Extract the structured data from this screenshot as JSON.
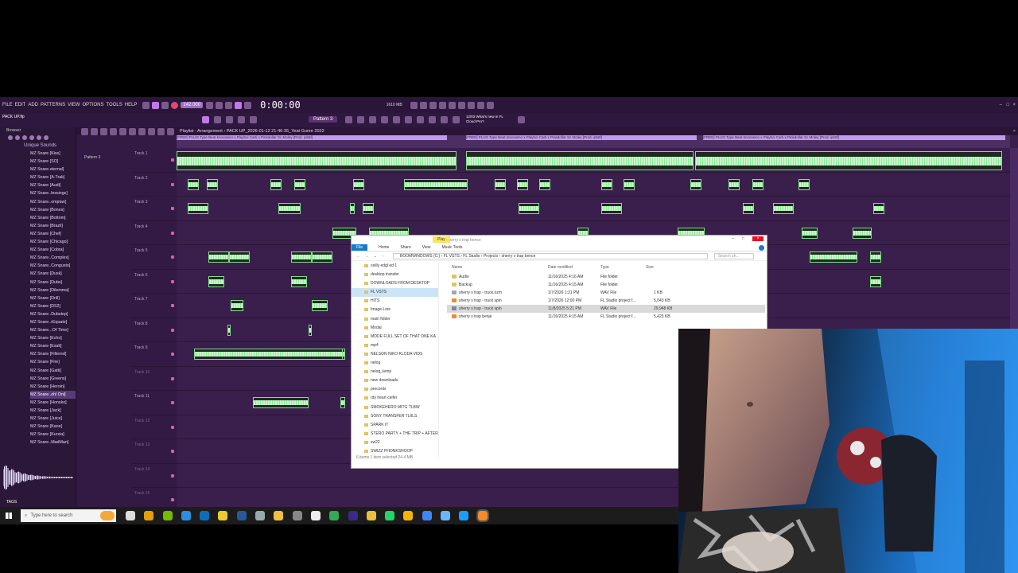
{
  "app": {
    "menu": [
      "FILE",
      "EDIT",
      "ADD",
      "PATTERNS",
      "VIEW",
      "OPTIONS",
      "TOOLS",
      "HELP"
    ],
    "tempo": "142.000",
    "time": "0:00:00",
    "pack_label": "PACK UP.flp",
    "pattern_select": "Pattern 3",
    "cloud_note_1": "12/03  What's new in FL",
    "cloud_note_2": "Cloud Pro?",
    "cpu_label": "1610 MB"
  },
  "browser": {
    "title": "Browser",
    "root": "Unique Sounds",
    "items": [
      "MZ Snare [Kiss]",
      "MZ Snare [SO]",
      "MZ Snare.eternal]",
      "MZ Snare [A-Trak]",
      "MZ Snare [Audi]",
      "MZ Snare..lessings]",
      "MZ Snare..omptan]",
      "MZ Snare [Bones]",
      "MZ Snare [Bottom]",
      "MZ Snare [Brazil]",
      "MZ Snare [Chef]",
      "MZ Snare [Chicago]",
      "MZ Snare [Cobra]",
      "MZ Snare..Complex]",
      "MZ Snare..Congusto]",
      "MZ Snare [Dusk]",
      "MZ Snare [Dubs]",
      "MZ Snare [Dilemma]",
      "MZ Snare [Drill]",
      "MZ Snare [DS2]",
      "MZ Snare..Dubstep]",
      "MZ Snare..rEquate]",
      "MZ Snare...Of Time]",
      "MZ Snare [Echo]",
      "MZ Snare [Exalt]",
      "MZ Snare [Filtered]",
      "MZ Snare [Fire]",
      "MZ Snare [Gatti]",
      "MZ Snare [Greens]",
      "MZ Snare [Heroin]",
      "MZ Snare..ohl Oni]",
      "MZ Snare [Honsko]",
      "MZ Snare [Jack]",
      "MZ Snare [Juice]",
      "MZ Snare [Kane]",
      "MZ Snare [Kurxia]",
      "MZ Snare..MadMan]"
    ],
    "selected_index": 30,
    "tags_label": "TAGS"
  },
  "playlist": {
    "title": "Playlist - Arrangement",
    "project": "PACK UP_2026-01-12 21-46-35_Yeat Gunnr 2022",
    "pattern_label": "Pattern 3",
    "tracks": [
      "Track 1",
      "Track 2",
      "Track 3",
      "Track 4",
      "Track 5",
      "Track 6",
      "Track 7",
      "Track 8",
      "Track 9",
      "Track 10",
      "Track 11",
      "Track 12",
      "Track 13",
      "Track 14",
      "Track 15"
    ],
    "clip_title_sample": "[FREE] PLUG Type Beat knocasino x Playboi Carti x Pinkdollar Sc Moley [Prod. ipb6f]"
  },
  "explorer": {
    "title": "sherry x trap bence",
    "play_tab": "Play",
    "ribbon": [
      "File",
      "Home",
      "Share",
      "View",
      "Music Tools"
    ],
    "path": [
      "BOOMWINDOWS (C:)",
      "FL VSTS",
      "FL Studio",
      "Projects",
      "sherry x trap bence"
    ],
    "search_placeholder": "Search sh...",
    "nav_items": [
      "ceilly edgl ed 1",
      "desktop transfer",
      "DOWNLOADS FROM DESKTOP",
      "FL VSTS",
      "HITS",
      "Image-Line",
      "main folder",
      "Modal",
      "MODE FULL SET OF THAT ONE KA",
      "mp4",
      "NELSON NIKO KLODA VIDS",
      "nelog",
      "nelog_temp",
      "new downloads",
      "precords",
      "rdy heart ceifer",
      "SMOKEHERO MITG TLBW",
      "SONY TRANSFER TLIILS",
      "SPARK IT",
      "STERO PARTY + THE TRIP + AFTER",
      "sw22",
      "SWIZZ PHONKSHOOP"
    ],
    "selected_nav": 3,
    "columns": [
      "Name",
      "Date modified",
      "Type",
      "Size"
    ],
    "files": [
      {
        "name": "Audio",
        "date": "11/16/2025 4:16 AM",
        "type": "File folder",
        "size": "",
        "icon": "folder"
      },
      {
        "name": "Backup",
        "date": "11/16/2025 4:15 AM",
        "type": "File folder",
        "size": "",
        "icon": "folder"
      },
      {
        "name": "sherry x trap - truck.ozm",
        "date": "1/7/2026 1:31 PM",
        "type": "WAV File",
        "size": "1 KB",
        "icon": "file"
      },
      {
        "name": "sherry x trap - truck spin",
        "date": "1/7/2026 12:00 PM",
        "type": "FL Studio project f...",
        "size": "5,043 KB",
        "icon": "fl"
      },
      {
        "name": "sherry x trap - truck spin",
        "date": "11/8/2025 5:21 PM",
        "type": "WAV File",
        "size": "29,948 KB",
        "icon": "wav"
      },
      {
        "name": "sherry x trap benje",
        "date": "11/16/2025 4:15 AM",
        "type": "FL Studio project f...",
        "size": "5,423 KB",
        "icon": "fl"
      }
    ],
    "selected_file": 4,
    "status": "6 items    1 item selected  24.4 MB"
  },
  "taskbar": {
    "search_placeholder": "Type here to search",
    "icons": [
      "task-view",
      "plex",
      "nvidia",
      "edge",
      "outlook",
      "chrome-beta",
      "word",
      "tool",
      "file-explorer",
      "xbox",
      "capcut",
      "chrome",
      "premiere",
      "folder",
      "whatsapp",
      "chrome-canary",
      "chrome-dev",
      "notepad",
      "mail",
      "fl-studio"
    ]
  },
  "colors": {
    "fl_bg": "#3a1f4c",
    "clip_green": "#7fdf88",
    "accent": "#c07ae8",
    "webcam_blue": "#2f9cff"
  }
}
